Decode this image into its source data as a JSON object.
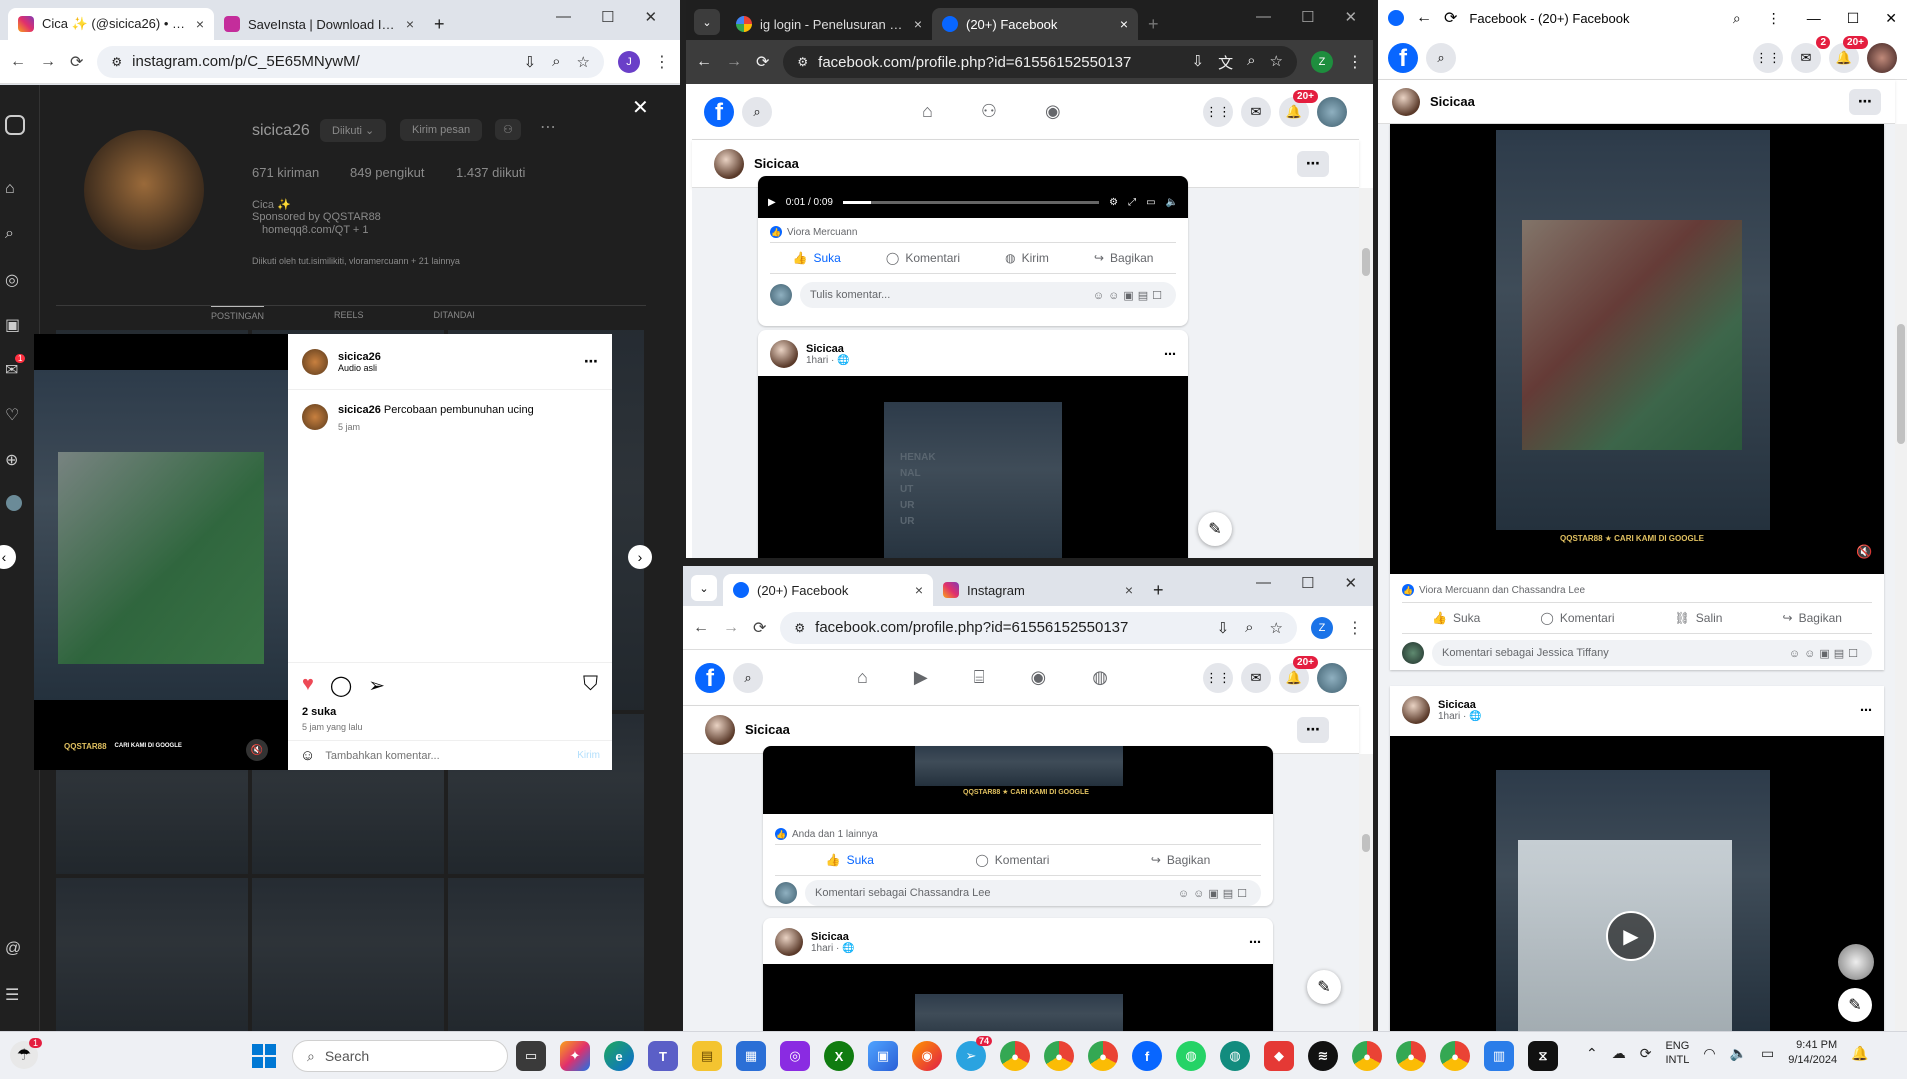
{
  "instagram_window": {
    "tabs": [
      {
        "label": "Cica ✨ (@sicica26) • Foto d…",
        "close": "×"
      },
      {
        "label": "SaveInsta | Download Instag…",
        "close": "×"
      }
    ],
    "new_tab": "+",
    "url": "instagram.com/p/C_5E65MNywM/",
    "profile_initial": "J",
    "profile": {
      "username": "sicica26",
      "follow_button": "Diikuti ⌄",
      "message_button": "Kirim pesan",
      "posts": "671 kiriman",
      "followers": "849 pengikut",
      "following": "1.437 diikuti",
      "display_name": "Cica ✨",
      "sponsor": "Sponsored by QQSTAR88",
      "link": "homeqq8.com/QT + 1",
      "followed_by": "Diikuti oleh tut.isimilikiti, vloramercuann + 21 lainnya",
      "tabs": [
        "POSTINGAN",
        "REELS",
        "DITANDAI"
      ]
    },
    "post": {
      "author": "sicica26",
      "audio": "Audio asli",
      "caption_user": "sicica26",
      "caption": "Percobaan pembunuhan ucing",
      "caption_time": "5 jam",
      "likes": "2 suka",
      "posted": "5 jam yang lalu",
      "comment_placeholder": "Tambahkan komentar...",
      "post_button": "Kirim",
      "video_brand": "QQSTAR88",
      "video_tag": "CARI KAMI DI GOOGLE"
    },
    "notification_badge": "1"
  },
  "fb_window_top": {
    "tabs": [
      {
        "label": "ig login - Penelusuran Goo…",
        "close": "×"
      },
      {
        "label": "(20+) Facebook",
        "close": "×"
      }
    ],
    "new_tab": "+",
    "url": "facebook.com/profile.php?id=61556152550137",
    "profile_initial": "Z",
    "notif_badge": "20+",
    "page_name": "Sicicaa",
    "video_time": "0:01 / 0:09",
    "reactions": "Viora Mercuann",
    "actions": [
      "Suka",
      "Komentari",
      "Kirim",
      "Bagikan"
    ],
    "comment_placeholder": "Tulis komentar...",
    "post2_name": "Sicicaa",
    "post2_time": "1hari · ",
    "side_text": "HENAK NAL UT UR UR"
  },
  "fb_window_bottom": {
    "tabs": [
      {
        "label": "(20+) Facebook",
        "close": "×"
      },
      {
        "label": "Instagram",
        "close": "×"
      }
    ],
    "new_tab": "+",
    "url": "facebook.com/profile.php?id=61556152550137",
    "profile_initial": "Z",
    "notif_badge": "20+",
    "page_name": "Sicicaa",
    "reactions": "Anda dan 1 lainnya",
    "actions": [
      "Suka",
      "Komentari",
      "Bagikan"
    ],
    "comment_placeholder": "Komentari sebagai Chassandra Lee",
    "post2_name": "Sicicaa",
    "post2_time": "1hari · "
  },
  "fb_window_right": {
    "title": "Facebook - (20+) Facebook",
    "messenger_badge": "2",
    "notif_badge": "20+",
    "page_name": "Sicicaa",
    "reactions": "Viora Mercuann dan Chassandra Lee",
    "actions": [
      "Suka",
      "Komentari",
      "Salin",
      "Bagikan"
    ],
    "comment_placeholder": "Komentari sebagai Jessica Tiffany",
    "post2_name": "Sicicaa",
    "post2_time": "1hari · "
  },
  "taskbar": {
    "search_placeholder": "Search",
    "language": "ENG",
    "layout": "INTL",
    "time": "9:41 PM",
    "date": "9/14/2024",
    "badges": {
      "left_widget": "1",
      "telegram": "74"
    }
  },
  "colors": {
    "facebook_blue": "#0866ff",
    "like_red": "#ed4956",
    "badge_red": "#e41e3f",
    "instagram_pink": "#e1306c"
  }
}
